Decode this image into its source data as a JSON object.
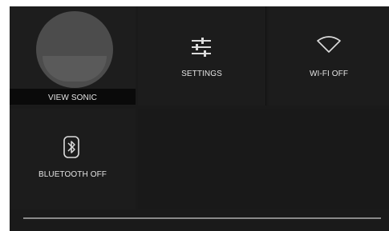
{
  "user": {
    "label": "VIEW SONIC",
    "icon": "user-avatar"
  },
  "settings": {
    "label": "SETTINGS",
    "icon": "sliders-icon"
  },
  "wifi": {
    "label": "WI-FI OFF",
    "icon": "wifi-icon"
  },
  "bluetooth": {
    "label": "BLUETOOTH OFF",
    "icon": "bluetooth-icon"
  },
  "brightness": {
    "level_fraction": 1.0
  },
  "colors": {
    "background": "#1a1a1a",
    "text": "#e4e4e4",
    "icon": "#dcdcdc"
  }
}
